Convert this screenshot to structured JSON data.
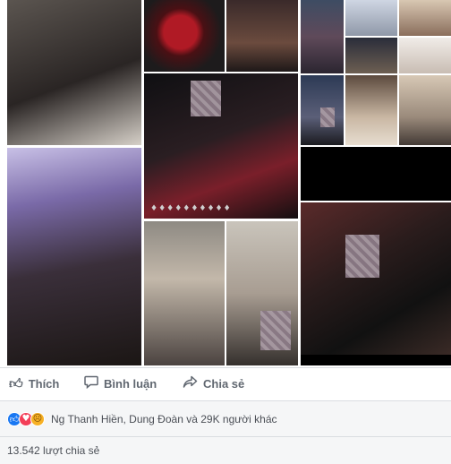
{
  "post": {
    "reactions_text": "Ng Thanh Hiền, Dung Đoàn và 29K người khác",
    "share_count_text": "13.542 lượt chia sẻ",
    "photo_caption_glyphs": "♦♦♦♦♦♦♦♦♦♦"
  },
  "actions": {
    "like_label": "Thích",
    "comment_label": "Bình luận",
    "share_label": "Chia sẻ",
    "like_icon": "thumbs-up-icon",
    "comment_icon": "speech-bubble-icon",
    "share_icon": "share-arrow-icon"
  },
  "reaction_icons": [
    "like-reaction-icon",
    "love-reaction-icon",
    "sad-reaction-icon"
  ],
  "colors": {
    "like_blue": "#1877f2",
    "love_red": "#f33e58",
    "sad_yellow": "#f7b125",
    "action_grey": "#606770",
    "footer_bg": "#f5f6f7"
  }
}
